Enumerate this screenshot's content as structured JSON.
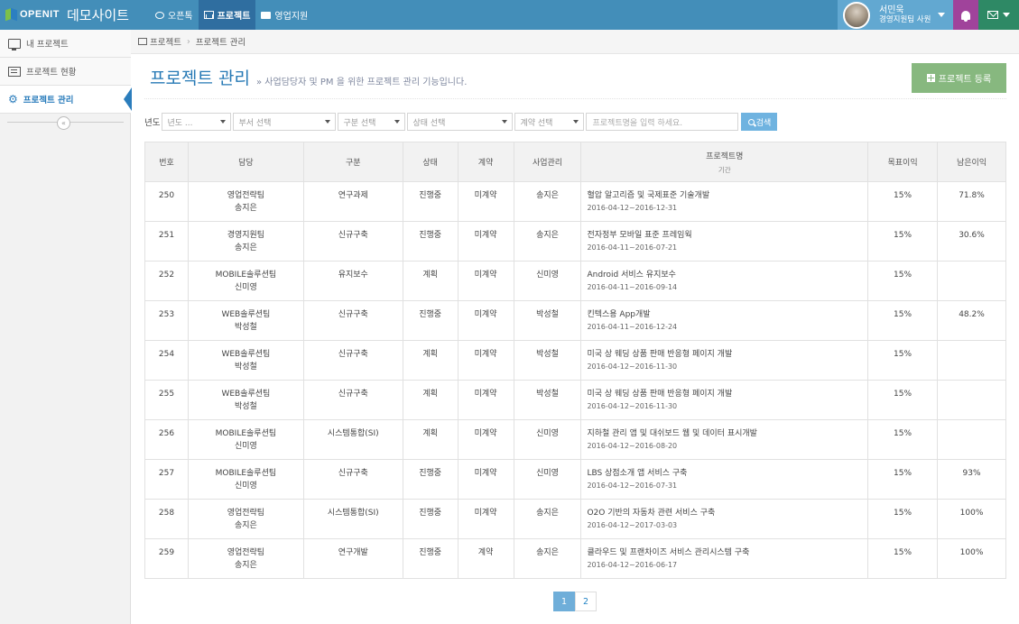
{
  "header": {
    "logo_text": "OPENIT",
    "site_name": "데모사이트",
    "nav": [
      {
        "label": "오픈톡",
        "icon": "chat-icon"
      },
      {
        "label": "프로젝트",
        "icon": "bar-chart-icon"
      },
      {
        "label": "영업지원",
        "icon": "briefcase-icon"
      }
    ],
    "user": {
      "name": "서민욱",
      "role": "경영지원팀 사원"
    }
  },
  "sidebar": {
    "items": [
      {
        "label": "내 프로젝트",
        "icon": "monitor-icon"
      },
      {
        "label": "프로젝트 현황",
        "icon": "list-icon"
      },
      {
        "label": "프로젝트 관리",
        "icon": "gear-icon"
      }
    ],
    "collapse_symbol": "«"
  },
  "breadcrumb": {
    "root": "프로젝트",
    "separator": "›",
    "current": "프로젝트 관리"
  },
  "page": {
    "title": "프로젝트 관리",
    "subtitle": "» 사업담당자 및 PM 을 위한 프로젝트 관리 기능입니다.",
    "register_label": "프로젝트 등록"
  },
  "filters": {
    "year_label": "년도",
    "year_placeholder": "년도 ...",
    "dept_placeholder": "부서 선택",
    "type_placeholder": "구분 선택",
    "status_placeholder": "상태 선택",
    "contract_placeholder": "계약 선택",
    "search_placeholder": "프로젝트명을 입력 하세요.",
    "search_button": "검색"
  },
  "table": {
    "headers": {
      "no": "번호",
      "owner": "담당",
      "type": "구분",
      "status": "상태",
      "contract": "계약",
      "manager": "사업관리",
      "name": "프로젝트명",
      "period": "기간",
      "target": "목표이익",
      "remaining": "남은이익"
    },
    "rows": [
      {
        "no": "250",
        "team": "영업전략팀",
        "person": "송지은",
        "type": "연구과제",
        "status": "진행중",
        "contract": "미계약",
        "manager": "송지은",
        "name": "혈압 알고리즘 및 국제표준 기술개발",
        "period": "2016-04-12~2016-12-31",
        "target": "15%",
        "remaining": "71.8%"
      },
      {
        "no": "251",
        "team": "경영지원팀",
        "person": "송지은",
        "type": "신규구축",
        "status": "진행중",
        "contract": "미계약",
        "manager": "송지은",
        "name": "전자정부 모바일 표준 프레임웍",
        "period": "2016-04-11~2016-07-21",
        "target": "15%",
        "remaining": "30.6%"
      },
      {
        "no": "252",
        "team": "MOBILE솔루션팀",
        "person": "신미영",
        "type": "유지보수",
        "status": "계획",
        "contract": "미계약",
        "manager": "신미영",
        "name": "Android 서비스 유지보수",
        "period": "2016-04-11~2016-09-14",
        "target": "15%",
        "remaining": ""
      },
      {
        "no": "253",
        "team": "WEB솔루션팀",
        "person": "박성철",
        "type": "신규구축",
        "status": "진행중",
        "contract": "미계약",
        "manager": "박성철",
        "name": "킨텍스용 App개발",
        "period": "2016-04-11~2016-12-24",
        "target": "15%",
        "remaining": "48.2%"
      },
      {
        "no": "254",
        "team": "WEB솔루션팀",
        "person": "박성철",
        "type": "신규구축",
        "status": "계획",
        "contract": "미계약",
        "manager": "박성철",
        "name": "미국 상 웨딩 상품 판매 반응형 페이지 개발",
        "period": "2016-04-12~2016-11-30",
        "target": "15%",
        "remaining": ""
      },
      {
        "no": "255",
        "team": "WEB솔루션팀",
        "person": "박성철",
        "type": "신규구축",
        "status": "계획",
        "contract": "미계약",
        "manager": "박성철",
        "name": "미국 상 웨딩 상품 판매 반응형 페이지 개발",
        "period": "2016-04-12~2016-11-30",
        "target": "15%",
        "remaining": ""
      },
      {
        "no": "256",
        "team": "MOBILE솔루션팀",
        "person": "신미영",
        "type": "시스템통합(SI)",
        "status": "계획",
        "contract": "미계약",
        "manager": "신미영",
        "name": "지하철 관리 앱 및 대쉬보드 웹 및 데이터 표시개발",
        "period": "2016-04-12~2016-08-20",
        "target": "15%",
        "remaining": ""
      },
      {
        "no": "257",
        "team": "MOBILE솔루션팀",
        "person": "신미영",
        "type": "신규구축",
        "status": "진행중",
        "contract": "미계약",
        "manager": "신미영",
        "name": "LBS 상점소개 앱 서비스 구축",
        "period": "2016-04-12~2016-07-31",
        "target": "15%",
        "remaining": "93%"
      },
      {
        "no": "258",
        "team": "영업전략팀",
        "person": "송지은",
        "type": "시스템통합(SI)",
        "status": "진행중",
        "contract": "미계약",
        "manager": "송지은",
        "name": "O2O 기반의 자동차 관련 서비스 구축",
        "period": "2016-04-12~2017-03-03",
        "target": "15%",
        "remaining": "100%"
      },
      {
        "no": "259",
        "team": "영업전략팀",
        "person": "송지은",
        "type": "연구개발",
        "status": "진행중",
        "contract": "계약",
        "manager": "송지은",
        "name": "클라우드 및 프랜차이즈 서비스 관리시스템 구축",
        "period": "2016-04-12~2016-06-17",
        "target": "15%",
        "remaining": "100%"
      }
    ]
  },
  "pagination": {
    "pages": [
      "1",
      "2"
    ],
    "current": "1"
  },
  "colors": {
    "navbar": "#438eb9",
    "active_nav": "#2f6ea0",
    "user_box": "#62a8d1",
    "bell_box": "#a0439b",
    "mail_box": "#2e8965",
    "title": "#2679b5",
    "register_button": "#87b87f",
    "search_button": "#6fb3e0"
  }
}
